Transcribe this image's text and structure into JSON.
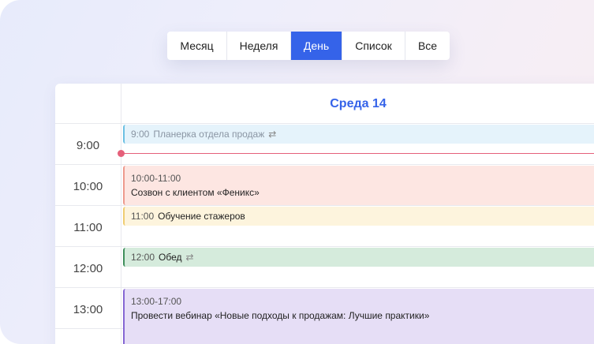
{
  "view_switcher": {
    "buttons": [
      {
        "label": "Месяц",
        "active": false
      },
      {
        "label": "Неделя",
        "active": false
      },
      {
        "label": "День",
        "active": true
      },
      {
        "label": "Список",
        "active": false
      },
      {
        "label": "Все",
        "active": false
      }
    ]
  },
  "calendar": {
    "day_title": "Среда 14",
    "hours": [
      "9:00",
      "10:00",
      "11:00",
      "12:00",
      "13:00"
    ],
    "events": [
      {
        "time": "9:00",
        "title": "Планерка отдела продаж",
        "recurring": true,
        "color": "#6cc0e3"
      },
      {
        "time": "10:00-11:00",
        "title": "Созвон с клиентом «Феникс»",
        "recurring": false,
        "color": "#ee9a8e"
      },
      {
        "time": "11:00",
        "title": "Обучение стажеров",
        "recurring": false,
        "color": "#f0cd72"
      },
      {
        "time": "12:00",
        "title": "Обед",
        "recurring": true,
        "color": "#3f8f5c"
      },
      {
        "time": "13:00-17:00",
        "title": "Провести вебинар «Новые подходы к продажам: Лучшие практики»",
        "recurring": false,
        "color": "#8566d4"
      }
    ]
  },
  "colors": {
    "accent": "#3563e9",
    "now_indicator": "#e5607a"
  },
  "icons": {
    "recurring": "repeat-icon"
  }
}
